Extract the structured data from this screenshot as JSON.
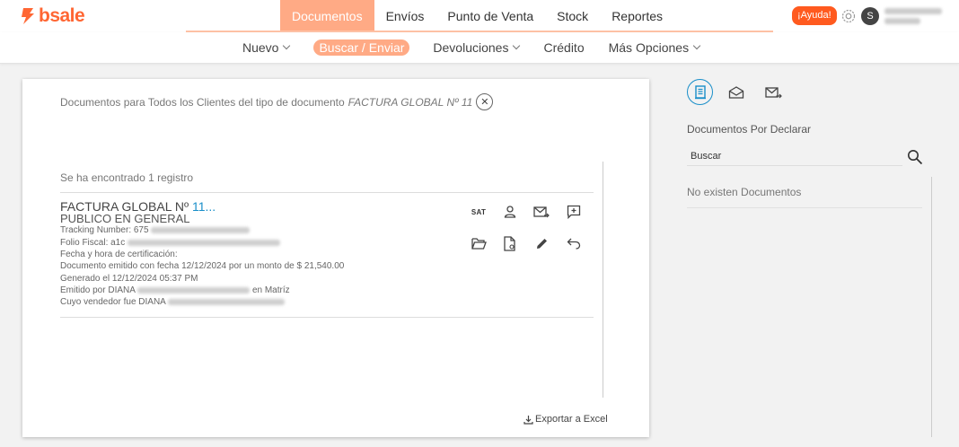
{
  "brand": {
    "name": "bsale",
    "color": "#ff6633"
  },
  "topnav": {
    "items": [
      "Documentos",
      "Envíos",
      "Punto de Venta",
      "Stock",
      "Reportes"
    ],
    "help": "¡Ayuda!",
    "avatar_initial": "S"
  },
  "subnav": {
    "items": [
      "Nuevo",
      "Buscar / Enviar",
      "Devoluciones",
      "Crédito",
      "Más Opciones"
    ]
  },
  "card": {
    "title_prefix": "Documentos para Todos los Clientes del tipo de documento",
    "doc_type": "FACTURA GLOBAL Nº 11",
    "records_found": "Se ha encontrado 1 registro",
    "doc": {
      "title": "FACTURA GLOBAL Nº",
      "number": "11...",
      "client": "PUBLICO EN GENERAL",
      "tracking_label": "Tracking Number: 675",
      "folio_label": "Folio Fiscal: a1c",
      "cert_label": "Fecha y hora de certificación:",
      "emitted": "Documento emitido con fecha 12/12/2024 por un monto de $ 21,540.00",
      "generated": "Generado el 12/12/2024 05:37 PM",
      "emitted_by_prefix": "Emitido por DIANA",
      "emitted_by_suffix": "en Matríz",
      "seller_prefix": "Cuyo vendedor fue DIANA"
    },
    "actions": {
      "sat": "SAT"
    },
    "export": "Exportar a Excel"
  },
  "right_panel": {
    "title": "Documentos Por Declarar",
    "search_placeholder": "Buscar",
    "empty": "No existen Documentos"
  },
  "colors": {
    "accent": "#ffaa85",
    "link": "#1a8fc9",
    "help": "#ff5a1f"
  }
}
